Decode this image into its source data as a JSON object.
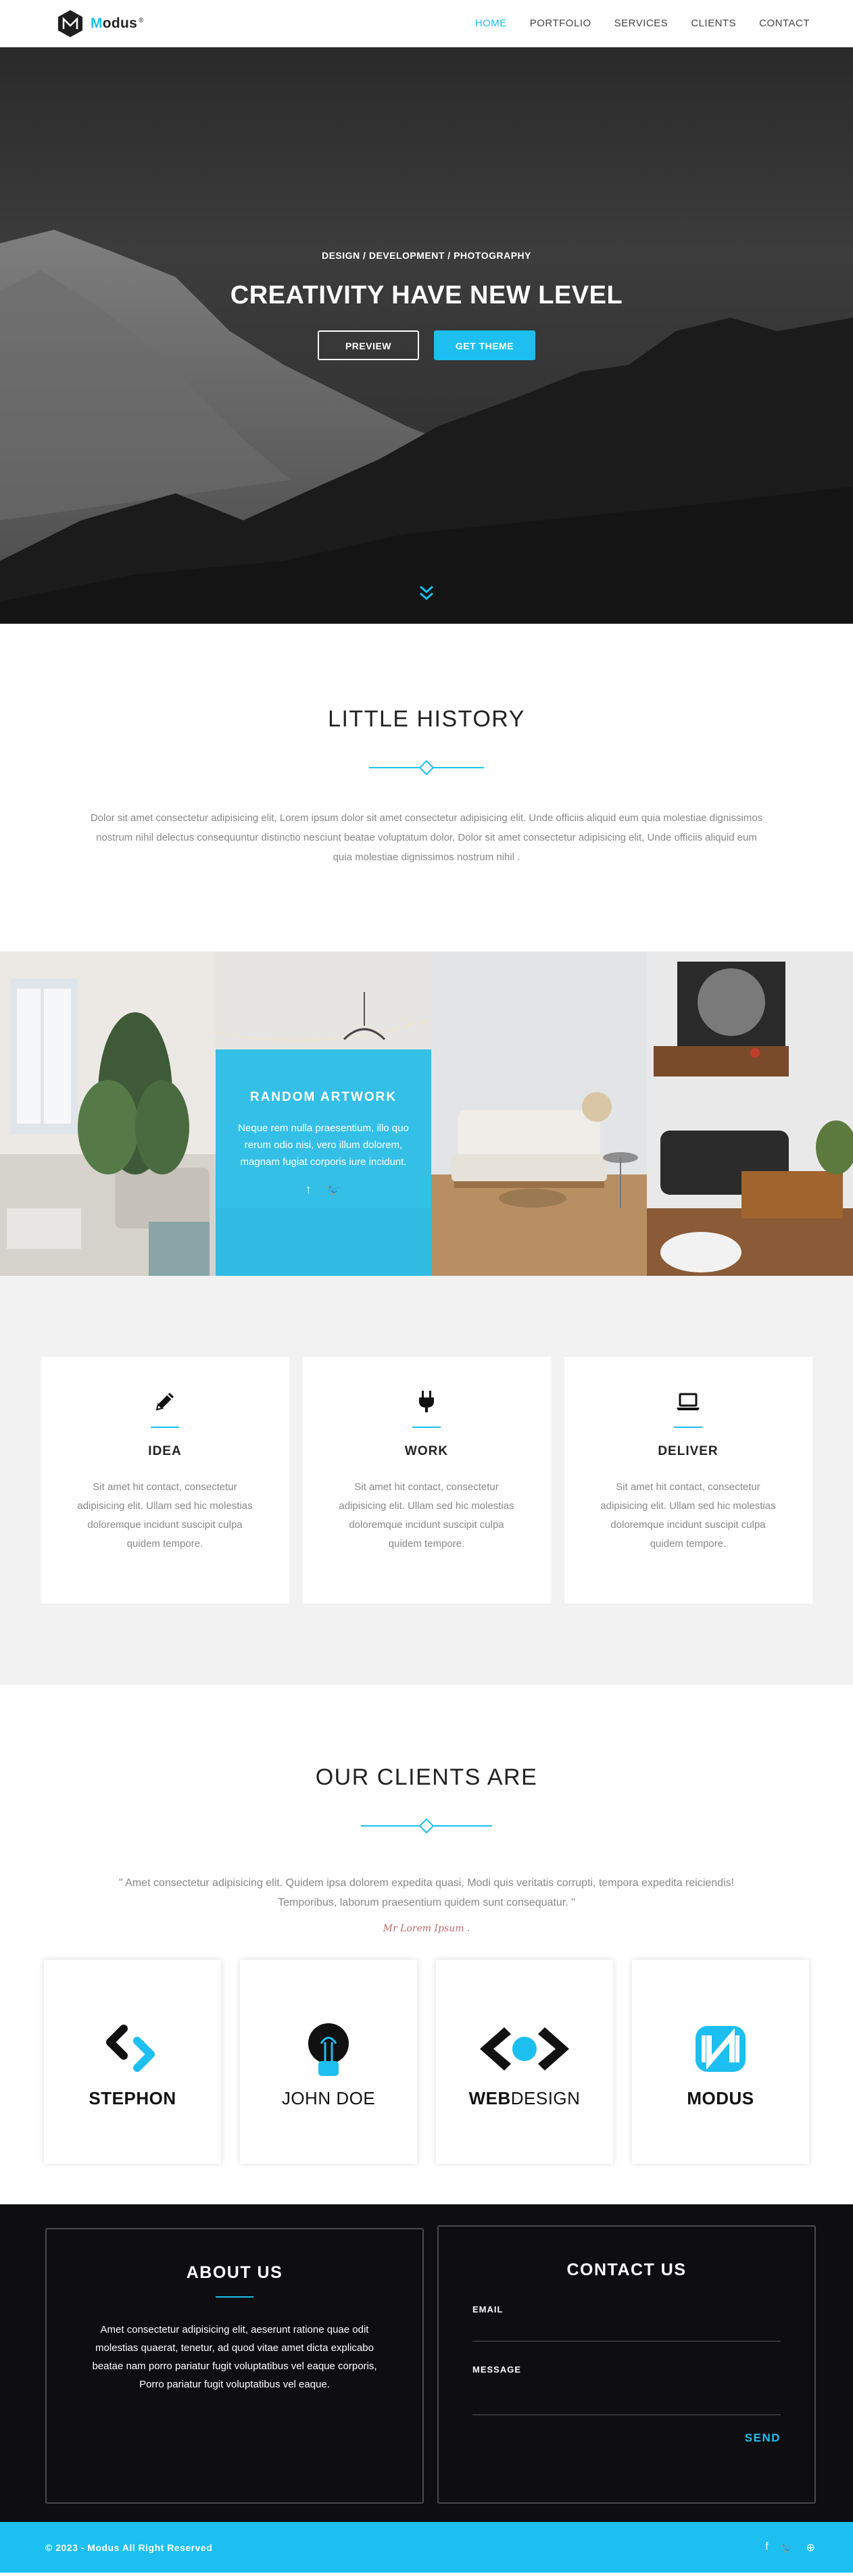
{
  "nav": {
    "brand_accent": "M",
    "brand_rest": "odus",
    "brand_sup": "®",
    "items": [
      {
        "label": "HOME",
        "active": true
      },
      {
        "label": "PORTFOLIO"
      },
      {
        "label": "SERVICES"
      },
      {
        "label": "CLIENTS"
      },
      {
        "label": "CONTACT"
      }
    ]
  },
  "hero": {
    "kicker": "DESIGN / DEVELOPMENT / PHOTOGRAPHY",
    "title": "CREATIVITY HAVE NEW LEVEL",
    "preview_label": "PREVIEW",
    "get_theme_label": "GET THEME"
  },
  "history": {
    "title": "LITTLE HISTORY",
    "text": "Dolor sit amet consectetur adipisicing elit, Lorem ipsum dolor sit amet consectetur adipisicing elit. Unde officiis aliquid eum quia molestiae dignissimos nostrum nihil delectus consequuntur distinctio nesciunt beatae voluptatum dolor, Dolor sit amet consectetur adipisicing elit, Unde officiis aliquid eum quia molestiae dignissimos nostrum nihil ."
  },
  "gallery": {
    "art_title": "RANDOM ARTWORK",
    "art_text": "Neque rem nulla praesentium, illo quo rerum odio nisi, vero illum dolorem, magnam fugiat corporis iure incidunt."
  },
  "services": [
    {
      "title": "IDEA",
      "icon": "pencil-icon",
      "text": "Sit amet hit contact, consectetur adipisicing elit. Ullam sed hic molestias doloremque incidunt suscipit culpa quidem tempore."
    },
    {
      "title": "WORK",
      "icon": "plug-icon",
      "text": "Sit amet hit contact, consectetur adipisicing elit. Ullam sed hic molestias doloremque incidunt suscipit culpa quidem tempore."
    },
    {
      "title": "DELIVER",
      "icon": "laptop-icon",
      "text": "Sit amet hit contact, consectetur adipisicing elit. Ullam sed hic molestias doloremque incidunt suscipit culpa quidem tempore."
    }
  ],
  "clients": {
    "title": "OUR CLIENTS ARE",
    "quote": "\" Amet consectetur adipisicing elit. Quidem ipsa dolorem expedita quasi, Modi quis veritatis corrupti, tempora expedita reiciendis! Temporibus, laborum praesentium quidem sunt consequatur. \"",
    "author": "Mr Lorem Ipsum .",
    "logos": [
      "STEPHON",
      "JOHN DOE",
      "WEBDESIGN",
      "MODUS"
    ],
    "web_bold": "WEB",
    "web_rest": "DESIGN"
  },
  "footer": {
    "about_title": "ABOUT US",
    "about_text": "Amet consectetur adipisicing elit, aeserunt ratione quae odit molestias quaerat, tenetur, ad quod vitae amet dicta explicabo beatae nam porro pariatur fugit voluptatibus vel eaque corporis, Porro pariatur fugit voluptatibus vel eaque.",
    "contact_title": "CONTACT US",
    "email_label": "EMAIL",
    "message_label": "MESSAGE",
    "send_label": "SEND",
    "copyright": "© 2023 - Modus All Right Reserved"
  },
  "colors": {
    "accent": "#1cbff0",
    "dark": "#0e0e10",
    "light_bg": "#f2f2f2"
  }
}
